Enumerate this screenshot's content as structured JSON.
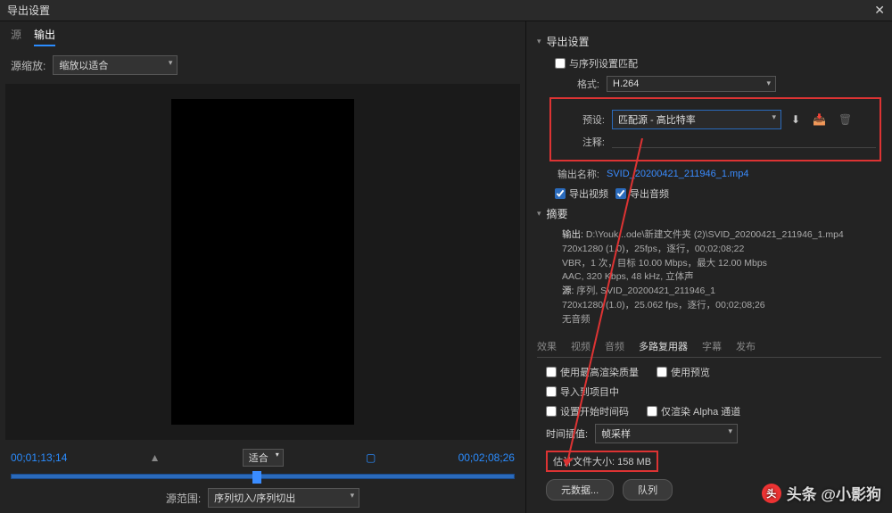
{
  "titlebar": {
    "title": "导出设置",
    "close": "✕"
  },
  "left": {
    "tabs": {
      "source": "源",
      "output": "输出"
    },
    "scale_label": "源缩放:",
    "scale_value": "缩放以适合",
    "tc_in": "00;01;13;14",
    "tc_out": "00;02;08;26",
    "fit": "适合",
    "range_label": "源范围:",
    "range_value": "序列切入/序列切出"
  },
  "right": {
    "export_settings": "导出设置",
    "match_sequence": "与序列设置匹配",
    "format_label": "格式:",
    "format_value": "H.264",
    "preset_label": "预设:",
    "preset_value": "匹配源 - 高比特率",
    "comments_label": "注释:",
    "output_name_label": "输出名称:",
    "output_name_value": "SVID_20200421_211946_1.mp4",
    "export_video": "导出视频",
    "export_audio": "导出音频",
    "summary_head": "摘要",
    "summary_out_label": "输出:",
    "summary_out_path": "D:\\Youk...ode\\新建文件夹 (2)\\SVID_20200421_211946_1.mp4",
    "summary_out_line2": "720x1280 (1.0)，25fps，逐行，00;02;08;22",
    "summary_out_line3": "VBR，1 次，目标 10.00 Mbps，最大 12.00 Mbps",
    "summary_out_line4": "AAC, 320 Kbps, 48 kHz, 立体声",
    "summary_src_label": "源:",
    "summary_src_line1": "序列, SVID_20200421_211946_1",
    "summary_src_line2": "720x1280 (1.0)，25.062 fps，逐行，00;02;08;26",
    "summary_src_line3": "无音频",
    "tabs": {
      "effects": "效果",
      "video": "视频",
      "audio": "音频",
      "mux": "多路复用器",
      "captions": "字幕",
      "publish": "发布"
    },
    "use_max_quality": "使用最高渲染质量",
    "use_preview": "使用预览",
    "import_project": "导入到项目中",
    "set_start_tc": "设置开始时间码",
    "render_alpha": "仅渲染 Alpha 通道",
    "interp_label": "时间插值:",
    "interp_value": "帧采样",
    "est_label": "估计文件大小:",
    "est_value": "158 MB",
    "btn_meta": "元数据...",
    "btn_queue": "队列"
  },
  "watermark": "头条 @小影狗"
}
